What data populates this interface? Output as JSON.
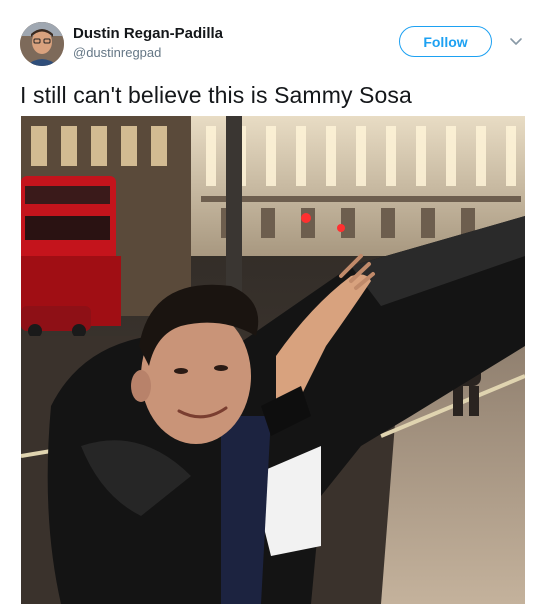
{
  "user": {
    "display_name": "Dustin Regan-Padilla",
    "handle": "@dustinregpad",
    "avatar": "user-avatar-photo"
  },
  "actions": {
    "follow_label": "Follow",
    "menu_icon": "chevron-down-icon"
  },
  "tweet": {
    "text": "I still can't believe this is Sammy Sosa"
  },
  "media": {
    "type": "photo",
    "icon": "photo-image"
  },
  "colors": {
    "accent": "#1da1f2",
    "text": "#14171a",
    "secondary_text": "#657786"
  }
}
